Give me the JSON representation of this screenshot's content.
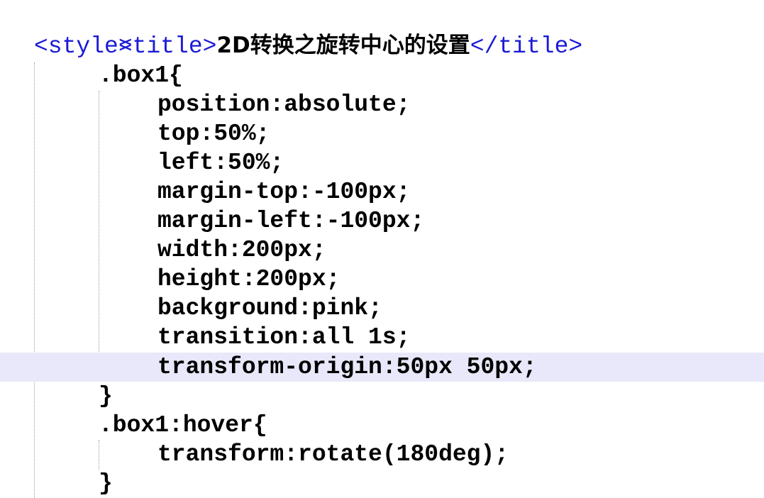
{
  "editor": {
    "colors": {
      "tag": "#1b1bd6",
      "code": "#000000",
      "current_line_bg": "#e8e8fa",
      "background": "#ffffff"
    },
    "lines": [
      {
        "open_tag": "<title>",
        "text": "2D转换之旋转中心的设置",
        "close_tag": "</title>"
      },
      {
        "open_tag": "<style>"
      },
      {
        "text": ".box1{"
      },
      {
        "text": "position:absolute;"
      },
      {
        "text": "top:50%;"
      },
      {
        "text": "left:50%;"
      },
      {
        "text": "margin-top:-100px;"
      },
      {
        "text": "margin-left:-100px;"
      },
      {
        "text": "width:200px;"
      },
      {
        "text": "height:200px;"
      },
      {
        "text": "background:pink;"
      },
      {
        "text": "transition:all 1s;"
      },
      {
        "text": "transform-origin:50px 50px;"
      },
      {
        "text": "}"
      },
      {
        "text": ".box1:hover{"
      },
      {
        "text": "transform:rotate(180deg);"
      },
      {
        "text": "}"
      }
    ]
  }
}
